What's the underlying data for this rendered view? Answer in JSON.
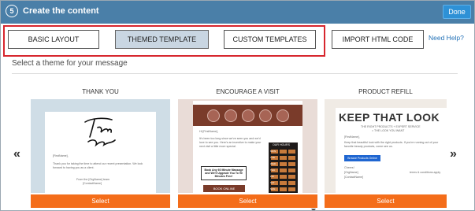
{
  "header": {
    "step_number": "5",
    "title": "Create the content",
    "done_label": "Done"
  },
  "tabs": [
    {
      "label": "BASIC LAYOUT",
      "active": false
    },
    {
      "label": "THEMED TEMPLATE",
      "active": true
    },
    {
      "label": "CUSTOM TEMPLATES",
      "active": false
    },
    {
      "label": "IMPORT HTML CODE",
      "active": false
    }
  ],
  "help_link": "Need Help?",
  "subtitle": "Select a theme for your message",
  "nav": {
    "prev": "«",
    "next": "»"
  },
  "themes": [
    {
      "title": "THANK YOU",
      "select_label": "Select",
      "preview": {
        "script_word": "Thank you",
        "greeting": "[FirstName],",
        "body": "Thank you for taking the time to attend our recent presentation. We look forward to having you as a client.",
        "from": "From the [OrgName] team",
        "contact": "[ContactName]"
      }
    },
    {
      "title": "ENCOURAGE A VISIT",
      "select_label": "Select",
      "preview": {
        "greeting": "Hi [FirstName],",
        "body": "It's been too long since we've seen you and we'd love to see you. Here's an incentive to make your next visit a little more special.",
        "offer": "Book Any 60 Minute Massage and We'll Upgrade You To 90 Minutes Free!",
        "cta": "BOOK ONLINE",
        "hours_title": "OUR HOURS",
        "hours_days": [
          "MON",
          "TUE",
          "WED",
          "THU",
          "FRI",
          "SAT",
          "SUN"
        ]
      }
    },
    {
      "title": "PRODUCT REFILL",
      "select_label": "Select",
      "preview": {
        "headline": "KEEP THAT LOOK",
        "tagline1": "THE RIGHT PRODUCTS + EXPERT SERVICE",
        "tagline2": "= THE LOOK YOU WANT",
        "greeting": "[FirstName],",
        "body": "Keep that beautiful look with the right products. If you're running out of your favorite beauty products, come see us.",
        "cta": "Browse Products Online",
        "signoff": "Cheers!",
        "org": "[OrgName]",
        "contact": "[ContactName]",
        "terms": "terms & conditions apply"
      }
    }
  ],
  "colors": {
    "header_bg": "#4a7fa8",
    "done_bg": "#2e91d6",
    "highlight": "#d7262e",
    "active_tab": "#c9d6e2",
    "select_bg": "#f46d1a",
    "link": "#2573b8"
  }
}
